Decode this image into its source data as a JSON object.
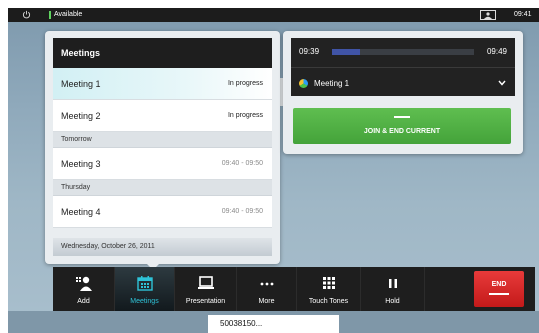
{
  "status_bar": {
    "availability": "Available",
    "clock": "09:41",
    "icons": [
      "power-icon",
      "selfview-icon"
    ]
  },
  "meetings": {
    "header": "Meetings",
    "items": [
      {
        "name": "Meeting 1",
        "status": "In progress"
      },
      {
        "name": "Meeting 2",
        "status": "In progress"
      },
      {
        "name": "Meeting 3",
        "status": "09:40 - 09:50"
      },
      {
        "name": "Meeting 4",
        "status": "09:40 - 09:50"
      }
    ],
    "dividers": [
      "Tomorrow",
      "Thursday"
    ],
    "footer_date": "Wednesday, October 26, 2011"
  },
  "current_call": {
    "start_time": "09:39",
    "end_time": "09:49",
    "progress_fraction": 0.2,
    "meeting_name": "Meeting 1",
    "join_button": "JOIN & END CURRENT"
  },
  "toolbar": {
    "add": "Add",
    "meetings": "Meetings",
    "presentation": "Presentation",
    "more": "More",
    "touch_tones": "Touch Tones",
    "hold": "Hold",
    "end": "END"
  },
  "dial": {
    "value": "50038150..."
  },
  "colors": {
    "accent": "#2ec3d8",
    "join_green": "#4caf45",
    "end_red": "#d82a2a",
    "progress_blue": "#4054a6",
    "available_green": "#5fd35f"
  }
}
